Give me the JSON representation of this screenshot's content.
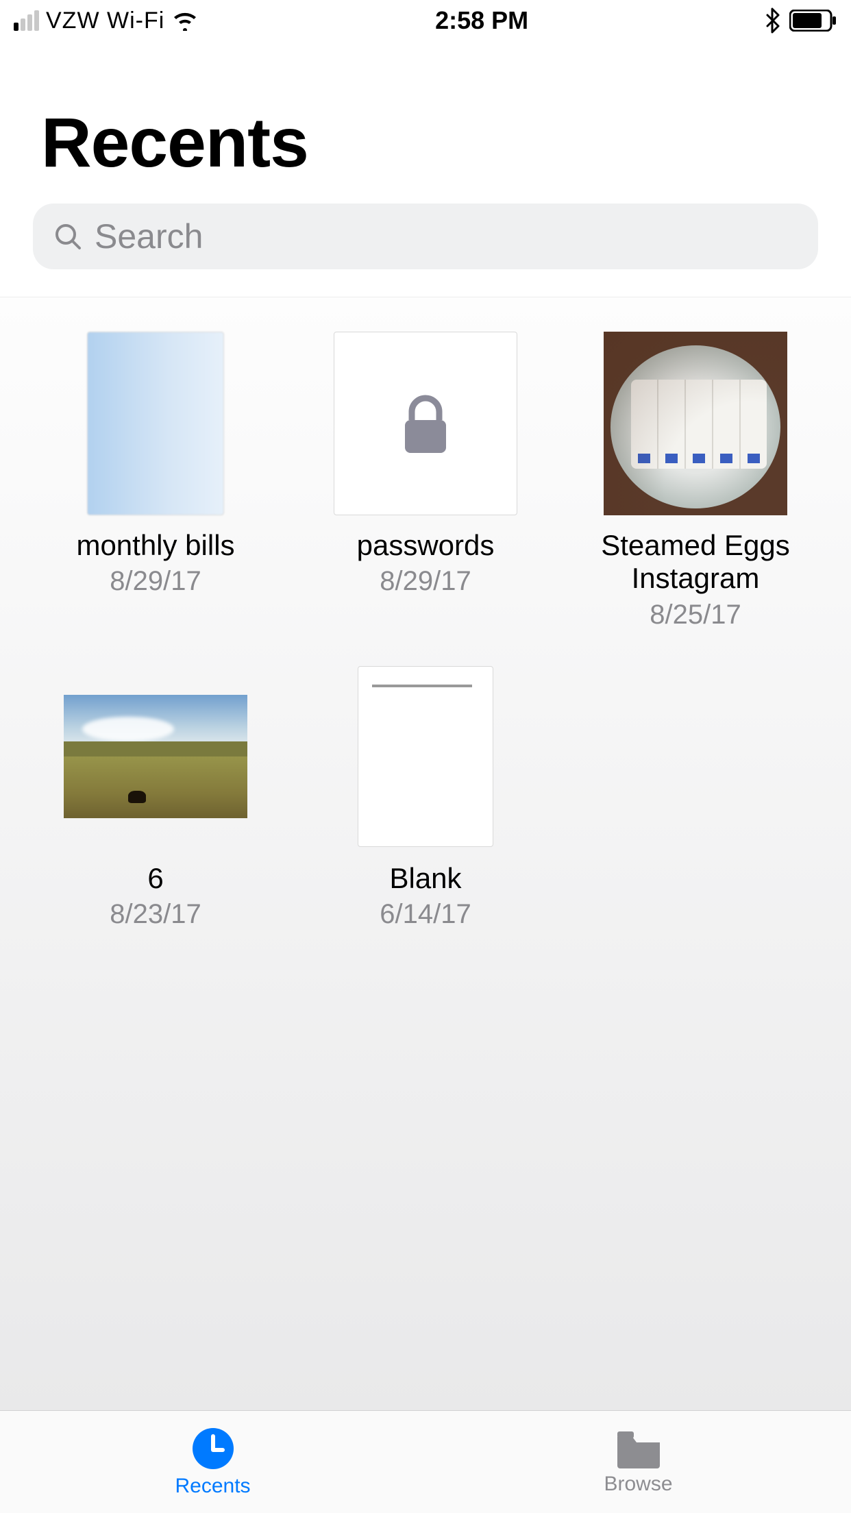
{
  "status": {
    "carrier": "VZW Wi-Fi",
    "time": "2:58 PM"
  },
  "header": {
    "title": "Recents"
  },
  "search": {
    "placeholder": "Search"
  },
  "files": [
    {
      "name": "monthly bills",
      "date": "8/29/17"
    },
    {
      "name": "passwords",
      "date": "8/29/17"
    },
    {
      "name": "Steamed Eggs Instagram",
      "date": "8/25/17"
    },
    {
      "name": "6",
      "date": "8/23/17"
    },
    {
      "name": "Blank",
      "date": "6/14/17"
    }
  ],
  "tabs": {
    "recents": "Recents",
    "browse": "Browse"
  }
}
